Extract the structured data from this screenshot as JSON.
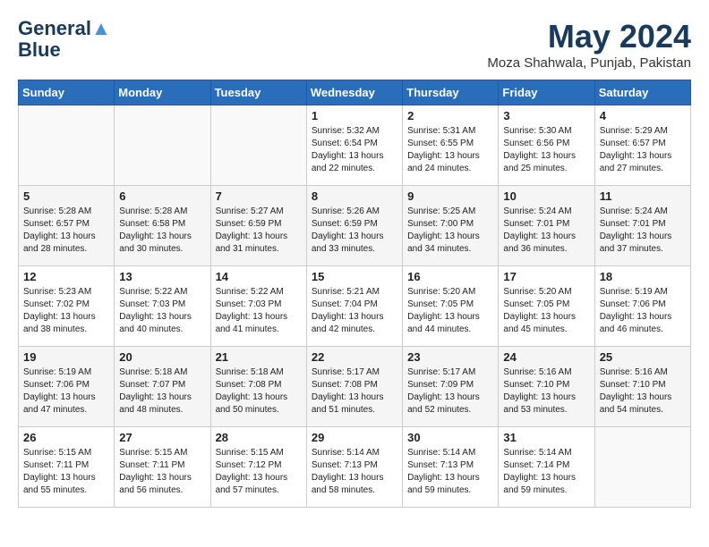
{
  "logo": {
    "line1": "General",
    "line2": "Blue"
  },
  "title": "May 2024",
  "location": "Moza Shahwala, Punjab, Pakistan",
  "days_of_week": [
    "Sunday",
    "Monday",
    "Tuesday",
    "Wednesday",
    "Thursday",
    "Friday",
    "Saturday"
  ],
  "weeks": [
    [
      {
        "day": "",
        "info": ""
      },
      {
        "day": "",
        "info": ""
      },
      {
        "day": "",
        "info": ""
      },
      {
        "day": "1",
        "info": "Sunrise: 5:32 AM\nSunset: 6:54 PM\nDaylight: 13 hours\nand 22 minutes."
      },
      {
        "day": "2",
        "info": "Sunrise: 5:31 AM\nSunset: 6:55 PM\nDaylight: 13 hours\nand 24 minutes."
      },
      {
        "day": "3",
        "info": "Sunrise: 5:30 AM\nSunset: 6:56 PM\nDaylight: 13 hours\nand 25 minutes."
      },
      {
        "day": "4",
        "info": "Sunrise: 5:29 AM\nSunset: 6:57 PM\nDaylight: 13 hours\nand 27 minutes."
      }
    ],
    [
      {
        "day": "5",
        "info": "Sunrise: 5:28 AM\nSunset: 6:57 PM\nDaylight: 13 hours\nand 28 minutes."
      },
      {
        "day": "6",
        "info": "Sunrise: 5:28 AM\nSunset: 6:58 PM\nDaylight: 13 hours\nand 30 minutes."
      },
      {
        "day": "7",
        "info": "Sunrise: 5:27 AM\nSunset: 6:59 PM\nDaylight: 13 hours\nand 31 minutes."
      },
      {
        "day": "8",
        "info": "Sunrise: 5:26 AM\nSunset: 6:59 PM\nDaylight: 13 hours\nand 33 minutes."
      },
      {
        "day": "9",
        "info": "Sunrise: 5:25 AM\nSunset: 7:00 PM\nDaylight: 13 hours\nand 34 minutes."
      },
      {
        "day": "10",
        "info": "Sunrise: 5:24 AM\nSunset: 7:01 PM\nDaylight: 13 hours\nand 36 minutes."
      },
      {
        "day": "11",
        "info": "Sunrise: 5:24 AM\nSunset: 7:01 PM\nDaylight: 13 hours\nand 37 minutes."
      }
    ],
    [
      {
        "day": "12",
        "info": "Sunrise: 5:23 AM\nSunset: 7:02 PM\nDaylight: 13 hours\nand 38 minutes."
      },
      {
        "day": "13",
        "info": "Sunrise: 5:22 AM\nSunset: 7:03 PM\nDaylight: 13 hours\nand 40 minutes."
      },
      {
        "day": "14",
        "info": "Sunrise: 5:22 AM\nSunset: 7:03 PM\nDaylight: 13 hours\nand 41 minutes."
      },
      {
        "day": "15",
        "info": "Sunrise: 5:21 AM\nSunset: 7:04 PM\nDaylight: 13 hours\nand 42 minutes."
      },
      {
        "day": "16",
        "info": "Sunrise: 5:20 AM\nSunset: 7:05 PM\nDaylight: 13 hours\nand 44 minutes."
      },
      {
        "day": "17",
        "info": "Sunrise: 5:20 AM\nSunset: 7:05 PM\nDaylight: 13 hours\nand 45 minutes."
      },
      {
        "day": "18",
        "info": "Sunrise: 5:19 AM\nSunset: 7:06 PM\nDaylight: 13 hours\nand 46 minutes."
      }
    ],
    [
      {
        "day": "19",
        "info": "Sunrise: 5:19 AM\nSunset: 7:06 PM\nDaylight: 13 hours\nand 47 minutes."
      },
      {
        "day": "20",
        "info": "Sunrise: 5:18 AM\nSunset: 7:07 PM\nDaylight: 13 hours\nand 48 minutes."
      },
      {
        "day": "21",
        "info": "Sunrise: 5:18 AM\nSunset: 7:08 PM\nDaylight: 13 hours\nand 50 minutes."
      },
      {
        "day": "22",
        "info": "Sunrise: 5:17 AM\nSunset: 7:08 PM\nDaylight: 13 hours\nand 51 minutes."
      },
      {
        "day": "23",
        "info": "Sunrise: 5:17 AM\nSunset: 7:09 PM\nDaylight: 13 hours\nand 52 minutes."
      },
      {
        "day": "24",
        "info": "Sunrise: 5:16 AM\nSunset: 7:10 PM\nDaylight: 13 hours\nand 53 minutes."
      },
      {
        "day": "25",
        "info": "Sunrise: 5:16 AM\nSunset: 7:10 PM\nDaylight: 13 hours\nand 54 minutes."
      }
    ],
    [
      {
        "day": "26",
        "info": "Sunrise: 5:15 AM\nSunset: 7:11 PM\nDaylight: 13 hours\nand 55 minutes."
      },
      {
        "day": "27",
        "info": "Sunrise: 5:15 AM\nSunset: 7:11 PM\nDaylight: 13 hours\nand 56 minutes."
      },
      {
        "day": "28",
        "info": "Sunrise: 5:15 AM\nSunset: 7:12 PM\nDaylight: 13 hours\nand 57 minutes."
      },
      {
        "day": "29",
        "info": "Sunrise: 5:14 AM\nSunset: 7:13 PM\nDaylight: 13 hours\nand 58 minutes."
      },
      {
        "day": "30",
        "info": "Sunrise: 5:14 AM\nSunset: 7:13 PM\nDaylight: 13 hours\nand 59 minutes."
      },
      {
        "day": "31",
        "info": "Sunrise: 5:14 AM\nSunset: 7:14 PM\nDaylight: 13 hours\nand 59 minutes."
      },
      {
        "day": "",
        "info": ""
      }
    ]
  ]
}
